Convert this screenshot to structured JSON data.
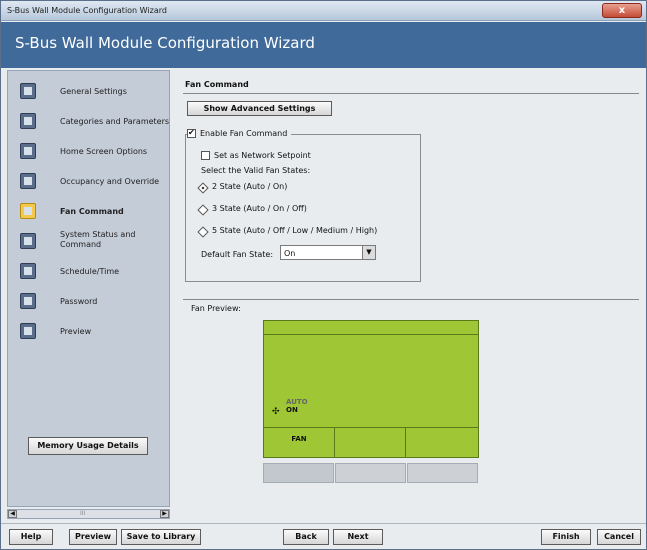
{
  "window": {
    "title": "S-Bus Wall Module Configuration Wizard",
    "close_glyph": "x"
  },
  "banner": {
    "title": "S-Bus Wall Module Configuration Wizard"
  },
  "sidebar": {
    "items": [
      {
        "label": "General Settings",
        "icon": "settings-icon"
      },
      {
        "label": "Categories and Parameters",
        "icon": "categories-icon"
      },
      {
        "label": "Home Screen Options",
        "icon": "home-screen-icon"
      },
      {
        "label": "Occupancy and Override",
        "icon": "occupancy-icon"
      },
      {
        "label": "Fan Command",
        "icon": "fan-icon",
        "selected": true
      },
      {
        "label": "System Status and Command",
        "icon": "system-status-icon"
      },
      {
        "label": "Schedule/Time",
        "icon": "schedule-icon"
      },
      {
        "label": "Password",
        "icon": "password-icon"
      },
      {
        "label": "Preview",
        "icon": "preview-icon"
      }
    ],
    "memory_button": "Memory Usage Details",
    "scroll_grip": "III"
  },
  "main": {
    "section_title": "Fan Command",
    "advanced_button": "Show Advanced Settings",
    "enable_label": "Enable Fan Command",
    "enable_checked": true,
    "network_label": "Set as Network Setpoint",
    "network_checked": false,
    "valid_states_label": "Select the Valid Fan States:",
    "states": [
      "2 State (Auto / On)",
      "3 State (Auto / On / Off)",
      "5 State (Auto / Off / Low / Medium / High)"
    ],
    "selected_state": 0,
    "default_label": "Default Fan State:",
    "default_value": "On",
    "preview_label": "Fan Preview:",
    "preview": {
      "auto": "AUTO",
      "on": "ON",
      "button1": "FAN",
      "screen_color": "#9ec635"
    }
  },
  "footer": {
    "help": "Help",
    "preview": "Preview",
    "save": "Save to Library",
    "back": "Back",
    "next": "Next",
    "finish": "Finish",
    "cancel": "Cancel"
  }
}
